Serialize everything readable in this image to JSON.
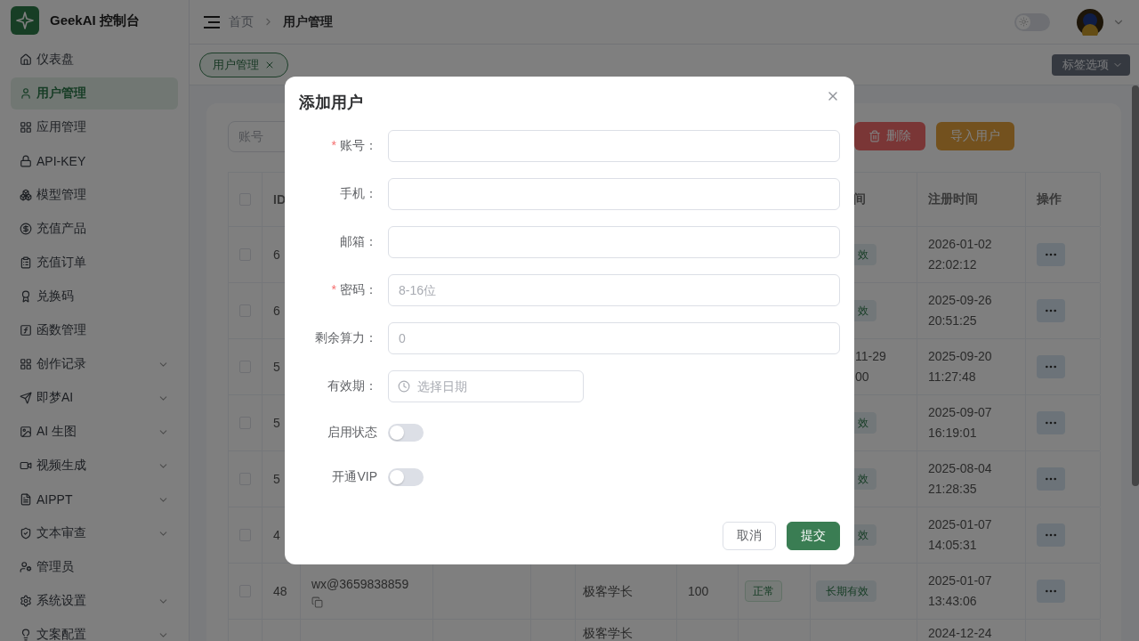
{
  "sidebar": {
    "brand": "GeekAI 控制台",
    "items": [
      {
        "label": "仪表盘",
        "selected": false,
        "has_submenu": false
      },
      {
        "label": "用户管理",
        "selected": true,
        "has_submenu": false
      },
      {
        "label": "应用管理",
        "selected": false,
        "has_submenu": false
      },
      {
        "label": "API-KEY",
        "selected": false,
        "has_submenu": false
      },
      {
        "label": "模型管理",
        "selected": false,
        "has_submenu": false
      },
      {
        "label": "充值产品",
        "selected": false,
        "has_submenu": false
      },
      {
        "label": "充值订单",
        "selected": false,
        "has_submenu": false
      },
      {
        "label": "兑换码",
        "selected": false,
        "has_submenu": false
      },
      {
        "label": "函数管理",
        "selected": false,
        "has_submenu": false
      },
      {
        "label": "创作记录",
        "selected": false,
        "has_submenu": true
      },
      {
        "label": "即梦AI",
        "selected": false,
        "has_submenu": true
      },
      {
        "label": "AI 生图",
        "selected": false,
        "has_submenu": true
      },
      {
        "label": "视频生成",
        "selected": false,
        "has_submenu": true
      },
      {
        "label": "AIPPT",
        "selected": false,
        "has_submenu": true
      },
      {
        "label": "文本审查",
        "selected": false,
        "has_submenu": true
      },
      {
        "label": "管理员",
        "selected": false,
        "has_submenu": false
      },
      {
        "label": "系统设置",
        "selected": false,
        "has_submenu": true
      },
      {
        "label": "文案配置",
        "selected": false,
        "has_submenu": true
      }
    ]
  },
  "header": {
    "breadcrumb": [
      "首页",
      "用户管理"
    ],
    "theme_toggle": {
      "on": false
    }
  },
  "tabs": [
    {
      "label": "用户管理",
      "selected": true
    }
  ],
  "tab_options": "标签选项",
  "toolbar": {
    "search": {
      "placeholder": "账号"
    },
    "buttons": [
      {
        "label": "删除",
        "kind": "danger"
      },
      {
        "label": "导入用户",
        "kind": "warning"
      }
    ]
  },
  "table": {
    "select_all": {
      "checked": false
    },
    "headers": {
      "id": "ID",
      "expiry": "间",
      "registered": "注册时间",
      "actions": "操作"
    },
    "rows": [
      {
        "checked": false,
        "id": "6",
        "expiry": {
          "kind": "tag",
          "text": "效"
        },
        "registered": "2026-01-02 22:02:12",
        "actions": true
      },
      {
        "checked": false,
        "id": "6",
        "expiry": {
          "kind": "tag",
          "text": "效"
        },
        "registered": "2025-09-26 20:51:25",
        "actions": true
      },
      {
        "checked": false,
        "id": "5",
        "expiry": {
          "kind": "text",
          "lines": [
            "11-29",
            "00"
          ]
        },
        "registered": "2025-09-20 11:27:48",
        "actions": true
      },
      {
        "checked": false,
        "id": "5",
        "expiry": {
          "kind": "tag",
          "text": "效"
        },
        "registered": "2025-09-07 16:19:01",
        "actions": true
      },
      {
        "checked": false,
        "id": "5",
        "expiry": {
          "kind": "tag",
          "text": "效"
        },
        "registered": "2025-08-04 21:28:35",
        "actions": true
      },
      {
        "checked": false,
        "id": "4",
        "expiry": {
          "kind": "tag",
          "text": "效"
        },
        "registered": "2025-01-07 14:05:31",
        "actions": true
      },
      {
        "checked": false,
        "id": "48",
        "account": "wx@3659838859",
        "nickname": "极客学长",
        "power": "100",
        "status": "正常",
        "expiry": {
          "kind": "tag",
          "text": "长期有效"
        },
        "registered": "2025-01-07 13:43:06",
        "actions": true
      },
      {
        "nickname": "极客学长",
        "registered": "2024-12-24"
      }
    ]
  },
  "dialog": {
    "title": "添加用户",
    "fields": [
      {
        "kind": "text",
        "label": "账号：",
        "required_mark": "*"
      },
      {
        "kind": "text",
        "label": "手机："
      },
      {
        "kind": "text",
        "label": "邮箱："
      },
      {
        "kind": "text",
        "label": "密码：",
        "required_mark": "*",
        "placeholder": "8-16位"
      },
      {
        "kind": "text",
        "label": "剩余算力：",
        "placeholder": "0"
      },
      {
        "kind": "date",
        "label": "有效期：",
        "placeholder": "选择日期"
      },
      {
        "kind": "switch",
        "label": "启用状态",
        "on": false
      },
      {
        "kind": "switch",
        "label": "开通VIP",
        "on": false
      }
    ],
    "buttons": [
      {
        "label": "取消",
        "kind": "default"
      },
      {
        "label": "提交",
        "kind": "primary"
      }
    ]
  }
}
